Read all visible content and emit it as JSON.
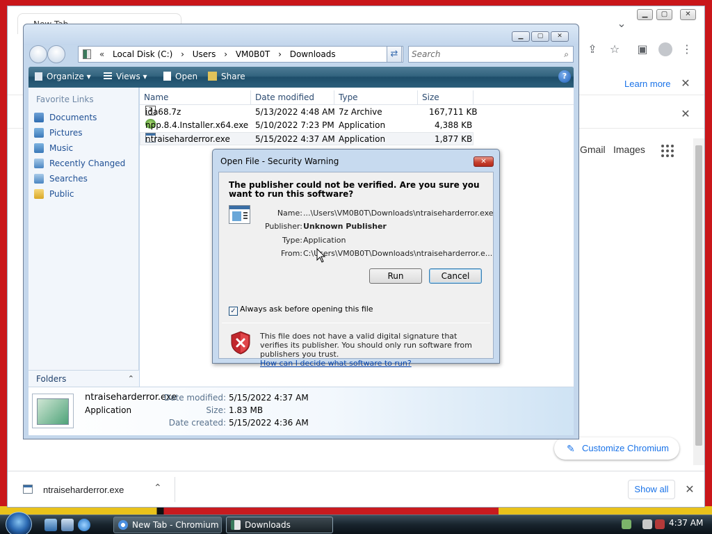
{
  "browser": {
    "tab_title": "New Tab",
    "learn_more": "Learn more",
    "links": [
      "Gmail",
      "Images"
    ],
    "customize": "Customize Chromium"
  },
  "downloads_bar": {
    "file": "ntraiseharderror.exe",
    "show_all": "Show all"
  },
  "explorer": {
    "address": [
      "Local Disk (C:)",
      "Users",
      "VM0B0T",
      "Downloads"
    ],
    "search_placeholder": "Search",
    "toolbar": [
      "Organize",
      "Views",
      "Open",
      "Share"
    ],
    "favorites_title": "Favorite Links",
    "favorites": [
      "Documents",
      "Pictures",
      "Music",
      "Recently Changed",
      "Searches",
      "Public"
    ],
    "folders_label": "Folders",
    "columns": [
      "Name",
      "Date modified",
      "Type",
      "Size"
    ],
    "files": [
      {
        "name": "ida68.7z",
        "date": "5/13/2022 4:48 AM",
        "type": "7z Archive",
        "size": "167,711 KB"
      },
      {
        "name": "npp.8.4.Installer.x64.exe",
        "date": "5/10/2022 7:23 PM",
        "type": "Application",
        "size": "4,388 KB"
      },
      {
        "name": "ntraiseharderror.exe",
        "date": "5/15/2022 4:37 AM",
        "type": "Application",
        "size": "1,877 KB"
      }
    ],
    "details": {
      "name": "ntraiseharderror.exe",
      "kind": "Application",
      "modified_label": "Date modified:",
      "modified": "5/15/2022 4:37 AM",
      "size_label": "Size:",
      "size": "1.83 MB",
      "created_label": "Date created:",
      "created": "5/15/2022 4:36 AM"
    }
  },
  "dialog": {
    "title": "Open File - Security Warning",
    "question": "The publisher could not be verified.  Are you sure you want to run this software?",
    "name_label": "Name:",
    "name": "...\\Users\\VM0B0T\\Downloads\\ntraiseharderror.exe",
    "publisher_label": "Publisher:",
    "publisher": "Unknown Publisher",
    "type_label": "Type:",
    "type": "Application",
    "from_label": "From:",
    "from": "C:\\Users\\VM0B0T\\Downloads\\ntraiseharderror.e...",
    "run": "Run",
    "cancel": "Cancel",
    "checkbox": "Always ask before opening this file",
    "warning": "This file does not have a valid digital signature that verifies its publisher.  You should only run software from publishers you trust.",
    "link": "How can I decide what software to run?"
  },
  "taskbar": {
    "tasks": [
      "New Tab - Chromium",
      "Downloads"
    ],
    "clock": "4:37 AM"
  }
}
